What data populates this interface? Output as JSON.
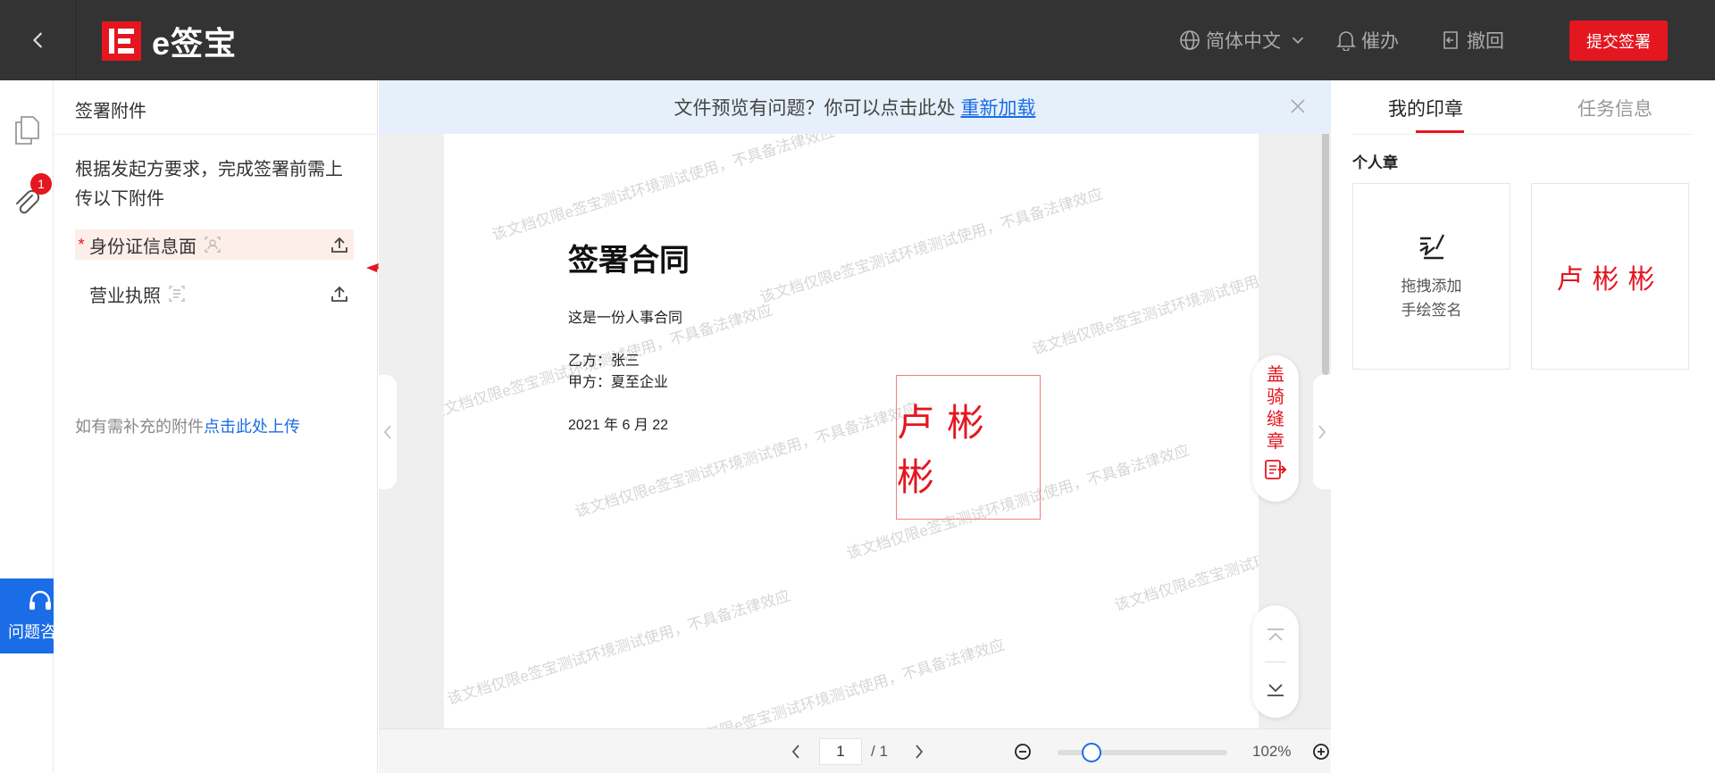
{
  "header": {
    "brand": "e签宝",
    "language": "简体中文",
    "urge": "催办",
    "withdraw": "撤回",
    "submit": "提交签署"
  },
  "rail": {
    "badge_count": "1",
    "help": "问题咨询"
  },
  "attachments": {
    "title": "签署附件",
    "description": "根据发起方要求，完成签署前需上传以下附件",
    "items": [
      {
        "required": "*",
        "name": "身份证信息面"
      },
      {
        "name": "营业执照"
      }
    ],
    "more_prefix": "如有需补充的附件",
    "more_link": "点击此处上传"
  },
  "notice": {
    "text": "文件预览有问题？你可以点击此处",
    "link": "重新加载"
  },
  "document": {
    "title": "签署合同",
    "lines": [
      "这是一份人事合同",
      "乙方：张三",
      "甲方：夏至企业",
      "2021 年  6 月 22"
    ],
    "seal": "卢彬彬",
    "watermark": "该文档仅限e签宝测试环境测试使用，不具备法律效应"
  },
  "tools": {
    "riding_seal": "盖骑缝章"
  },
  "pager": {
    "current": "1",
    "total": "/ 1",
    "zoom": "102%",
    "zoom_fraction": 0.2
  },
  "right": {
    "tabs": [
      "我的印章",
      "任务信息"
    ],
    "section": "个人章",
    "handwrite_line1": "拖拽添加",
    "handwrite_line2": "手绘签名",
    "stamp": "卢彬彬"
  },
  "colors": {
    "brand_red": "#e4161f",
    "link_blue": "#1a6de6",
    "topbar": "#333333"
  }
}
